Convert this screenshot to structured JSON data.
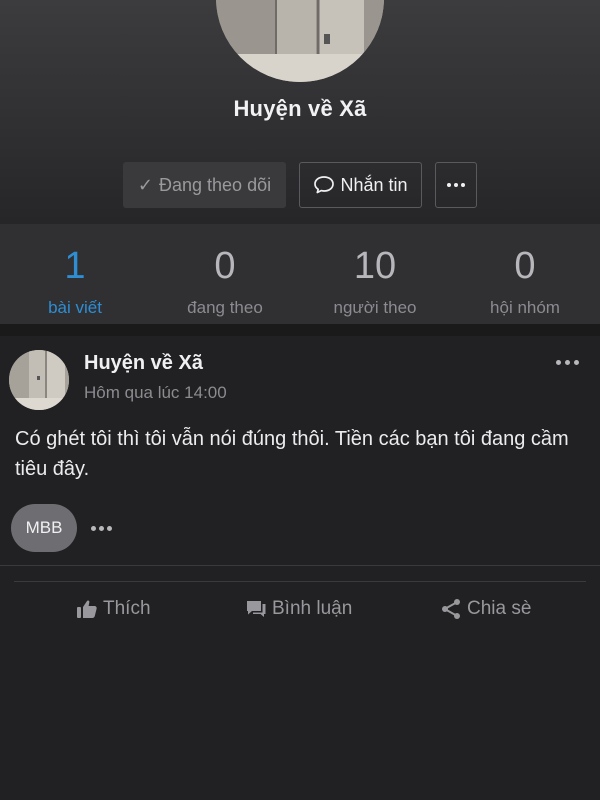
{
  "profile": {
    "name": "Huyện về Xã",
    "following_label": "Đang theo dõi",
    "message_label": "Nhắn tin"
  },
  "stats": [
    {
      "value": "1",
      "label": "bài viết"
    },
    {
      "value": "0",
      "label": "đang theo"
    },
    {
      "value": "10",
      "label": "người theo"
    },
    {
      "value": "0",
      "label": "hội nhóm"
    }
  ],
  "post": {
    "author": "Huyện về Xã",
    "time": "Hôm qua lúc 14:00",
    "text": "Có ghét tôi thì tôi vẫn nói đúng thôi. Tiền các bạn tôi đang cầm tiêu đây.",
    "tag": "MBB",
    "actions": {
      "like": "Thích",
      "comment": "Bình luận",
      "share": "Chia sè"
    }
  },
  "colors": {
    "accent": "#2e8dd3",
    "background": "#212123",
    "header": "#303032"
  },
  "icons": [
    "check-icon",
    "chat-bubble-icon",
    "more-dots-icon",
    "thumbs-up-icon",
    "comment-icon",
    "share-icon"
  ]
}
